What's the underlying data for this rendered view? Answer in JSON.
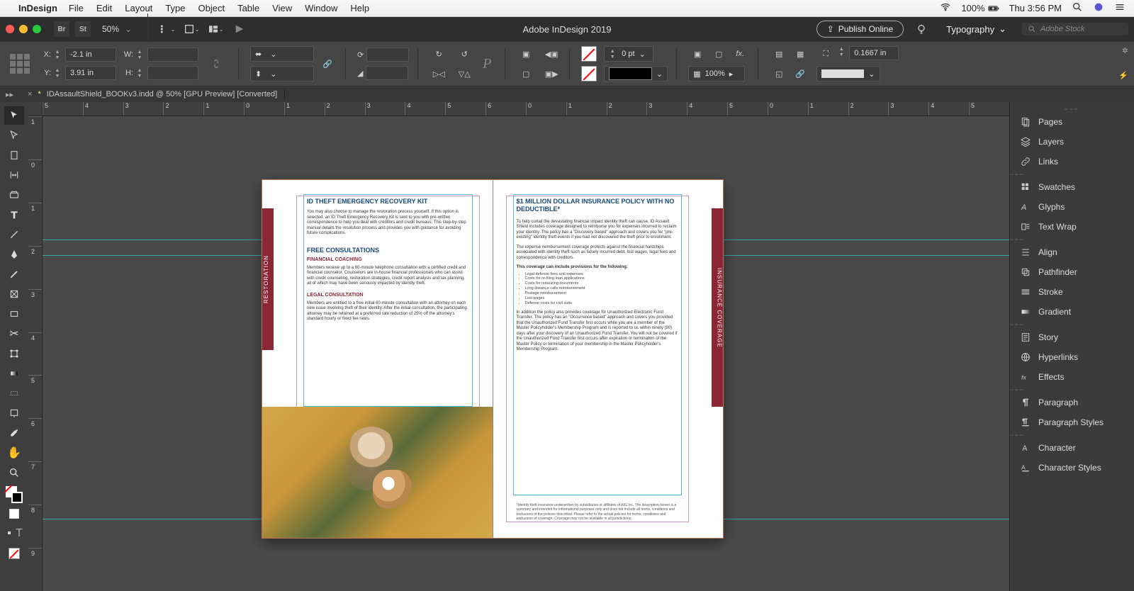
{
  "menubar": {
    "app": "InDesign",
    "items": [
      "File",
      "Edit",
      "Layout",
      "Type",
      "Object",
      "Table",
      "View",
      "Window",
      "Help"
    ],
    "battery": "100%",
    "clock": "Thu 3:56 PM"
  },
  "appbar": {
    "br": "Br",
    "st": "St",
    "zoom": "50%",
    "title": "Adobe InDesign 2019",
    "publish": "Publish Online",
    "workspace": "Typography",
    "search_placeholder": "Adobe Stock"
  },
  "control": {
    "x_label": "X:",
    "x": "-2.1 in",
    "y_label": "Y:",
    "y": "3.91 in",
    "w_label": "W:",
    "w": "",
    "h_label": "H:",
    "h": "",
    "stroke": "0 pt",
    "pct": "100%",
    "gutter": "0.1667 in"
  },
  "doctab": {
    "name": "IDAssaultShield_BOOKv3.indd @ 50% [GPU Preview] [Converted]"
  },
  "ruler_h": [
    "5",
    "4",
    "3",
    "2",
    "1",
    "0",
    "1",
    "2",
    "3",
    "4",
    "5",
    "6",
    "0",
    "1",
    "2",
    "3",
    "4",
    "5",
    "0",
    "1",
    "2",
    "3",
    "4",
    "5"
  ],
  "ruler_v": [
    "1",
    "0",
    "1",
    "2",
    "3",
    "4",
    "5",
    "6",
    "7",
    "8",
    "9"
  ],
  "panels": {
    "g1": [
      "Pages",
      "Layers",
      "Links"
    ],
    "g2": [
      "Swatches",
      "Glyphs",
      "Text Wrap"
    ],
    "g3": [
      "Align",
      "Pathfinder",
      "Stroke",
      "Gradient"
    ],
    "g4": [
      "Story",
      "Hyperlinks",
      "Effects"
    ],
    "g5": [
      "Paragraph",
      "Paragraph Styles"
    ],
    "g6": [
      "Character",
      "Character Styles"
    ]
  },
  "doc": {
    "left": {
      "sidetab": "RESTORATION",
      "h1": "ID THEFT EMERGENCY RECOVERY KIT",
      "p1": "You may also choose to manage the restoration process yourself. If this option is selected, an ID Theft Emergency Recovery Kit is sent to you with pre-written correspondence to help you deal with creditors and credit bureaus. This step-by-step manual details the resolution process and provides you with guidance for avoiding future complications.",
      "h2": "FREE CONSULTATIONS",
      "h3": "FINANCIAL COACHING",
      "p2": "Members receive up to a 60-minute telephone consultation with a certified credit and financial counselor. Counselors are in-house financial professionals who can assist with credit counseling, restoration strategies, credit report analysis and tax planning, all of which may have been seriously impacted by identity theft.",
      "h4": "LEGAL CONSULTATION",
      "p3": "Members are entitled to a free initial 60-minute consultation with an attorney on each new issue involving theft of their identity. After the initial consultation, the participating attorney may be retained at a preferred rate reduction of 25% off the attorney's standard hourly or fixed fee rates."
    },
    "right": {
      "sidetab": "INSURANCE COVERAGE",
      "h1": "$1 MILLION DOLLAR INSURANCE POLICY WITH NO DEDUCTIBLE*",
      "p1": "To help curtail the devastating financial impact identity theft can cause, ID Assault Shield includes coverage designed to reimburse you for expenses incurred to reclaim your identity. The policy has a \"Discovery based\" approach and covers you for \"pre-existing\" identity theft events if you had not discovered the theft prior to enrollment.",
      "p2": "The expense reimbursement coverage protects against the financial hardships associated with identity theft such as falsely incurred debt, lost wages, legal fees and correspondence with creditors.",
      "lead": "This coverage can include provisions for the following:",
      "list": [
        "Legal defense fees and expenses",
        "Costs for re-filing loan applications",
        "Costs for notarizing documents",
        "Long distance calls reimbursement",
        "Postage reimbursement",
        "Lost wages",
        "Defense costs for civil suits"
      ],
      "p3": "In addition the policy also provides coverage for Unauthorized Electronic Fund Transfer. The policy has an \"Occurrence based\" approach and covers you provided that the Unauthorized Fund Transfer first occurs while you are a member of the Master Policyholder's Membership Program and is reported to us within ninety (90) days after your discovery of an Unauthorized Fund Transfer. You will not be covered if the Unauthorized Fund Transfer first occurs after expiration or termination of the Master Policy or termination of your membership in the Master Policyholder's Membership Program.",
      "foot": "*Identity theft insurance underwritten by subsidiaries or affiliates of AIG Inc. The description herein is a summary and intended for informational purposes only and does not include all terms, conditions and exclusions of the policies described. Please refer to the actual policies for terms, conditions and exclusions of coverage. Coverage may not be available in all jurisdictions."
    }
  }
}
